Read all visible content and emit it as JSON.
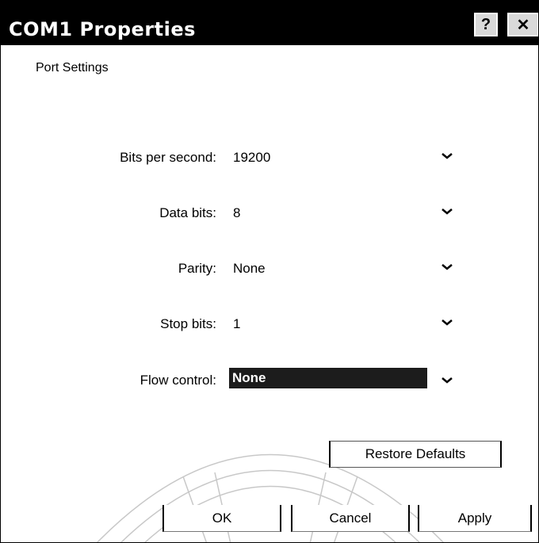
{
  "window": {
    "title": "COM1 Properties",
    "help_icon": "question-mark-icon",
    "close_icon": "close-icon"
  },
  "tab": {
    "label": "Port Settings"
  },
  "fields": [
    {
      "label": "Bits per second:",
      "value": "19200"
    },
    {
      "label": "Data bits:",
      "value": "8"
    },
    {
      "label": "Parity:",
      "value": "None"
    },
    {
      "label": "Stop bits:",
      "value": "1"
    },
    {
      "label": "Flow control:",
      "value": "None"
    }
  ],
  "buttons": {
    "restore": "Restore Defaults",
    "ok": "OK",
    "cancel": "Cancel",
    "apply": "Apply"
  },
  "colors": {
    "titlebar": "#000000",
    "selection": "#1c1c1c"
  }
}
